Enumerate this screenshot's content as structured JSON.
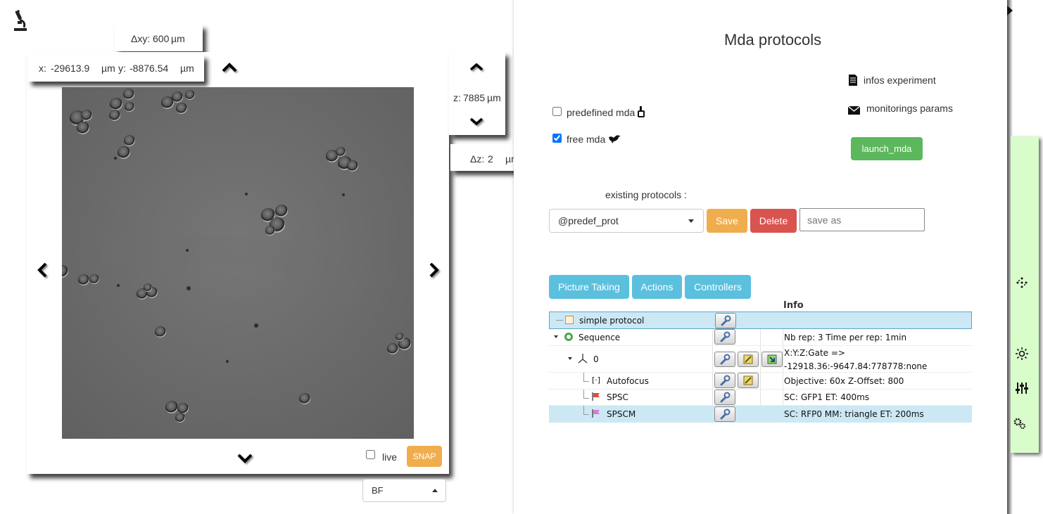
{
  "viewer": {
    "dxy_label": "Δxy:",
    "dxy_value": "600",
    "dxy_unit": "µm",
    "x_label": "x:",
    "x_value": "-29613.9",
    "x_unit": "µm",
    "y_label": "y:",
    "y_value": "-8876.54",
    "y_unit": "µm",
    "z_label": "z:",
    "z_value": "7885",
    "z_unit": "µm",
    "dz_label": "Δz:",
    "dz_value": "2",
    "dz_unit": "µm",
    "live_label": "live",
    "live_checked": false,
    "snap_label": "SNAP",
    "channel_value": "BF"
  },
  "mda": {
    "title": "Mda protocols",
    "predefined_label": "predefined mda",
    "predefined_checked": false,
    "free_label": "free mda",
    "free_checked": true,
    "infos_experiment": "infos experiment",
    "monitorings_params": "monitorings params",
    "launch_label": "launch_mda",
    "existing_label": "existing protocols :",
    "protocol_value": "@predef_prot",
    "save_label": "Save",
    "delete_label": "Delete",
    "save_as_placeholder": "save as",
    "tabs": [
      "Picture Taking",
      "Actions",
      "Controllers"
    ],
    "info_header": "Info",
    "tree": [
      {
        "name": "simple protocol",
        "info": "",
        "info2": ""
      },
      {
        "name": "Sequence",
        "info": "Nb rep: 3 Time per rep: 1min",
        "info2": ""
      },
      {
        "name": "0",
        "info": "X:Y:Z:Gate =>",
        "info2": "-12918.36:-9647.84:778778:none"
      },
      {
        "name": "Autofocus",
        "info": "Objective: 60x Z-Offset: 800",
        "info2": ""
      },
      {
        "name": "SPSC",
        "info": "SC: GFP1 ET: 400ms",
        "info2": ""
      },
      {
        "name": "SPSCM",
        "info": "SC: RFP0 MM: triangle ET: 200ms",
        "info2": ""
      }
    ]
  },
  "colors": {
    "snap": "#f0ad4e",
    "save": "#f0ad4e",
    "delete": "#d9534f",
    "launch": "#5cb85c",
    "tab": "#5bc0de",
    "selected_row": "#cce8f4",
    "side_panel": "#d9fccb"
  },
  "icons": [
    "microscope-icon",
    "document-icon",
    "envelope-icon",
    "hand-icon",
    "bird-icon",
    "wrench-icon",
    "sun-icon",
    "sliders-icon",
    "gears-icon",
    "move-dots-icon"
  ]
}
